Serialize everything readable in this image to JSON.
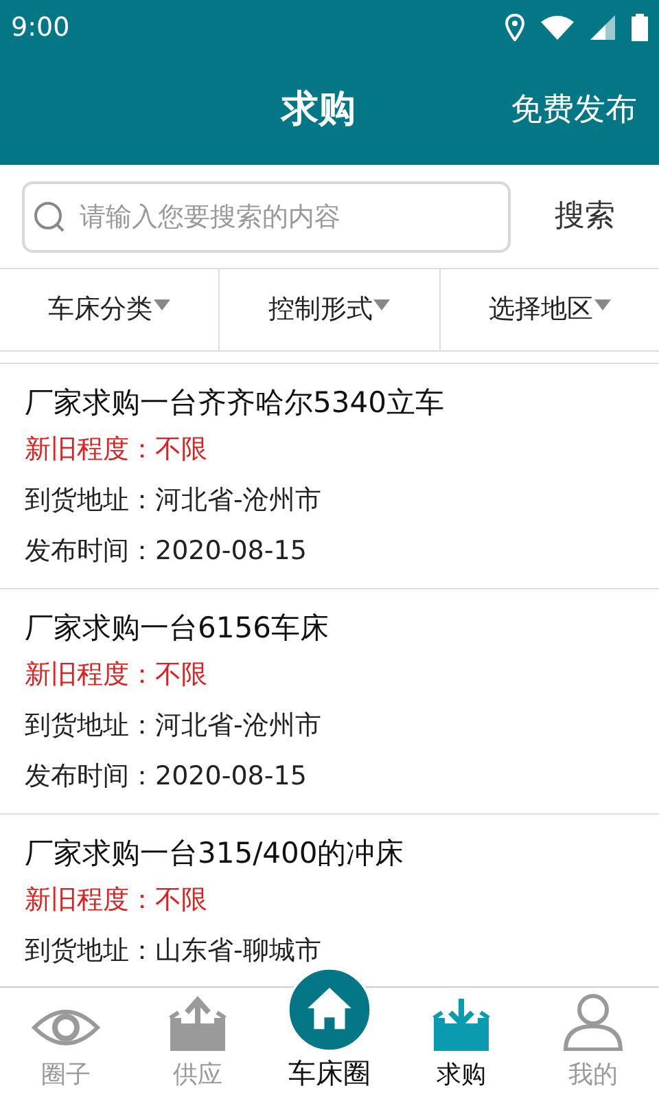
{
  "status_bar": {
    "time": "9:00"
  },
  "header": {
    "title": "求购",
    "action": "免费发布"
  },
  "search": {
    "placeholder": "请输入您要搜索的内容",
    "button": "搜索"
  },
  "filters": [
    {
      "label": "车床分类"
    },
    {
      "label": "控制形式"
    },
    {
      "label": "选择地区"
    }
  ],
  "listings": [
    {
      "title": "厂家求购一台齐齐哈尔5340立车",
      "condition": "新旧程度：不限",
      "address": "到货地址：河北省-沧州市",
      "date": "发布时间：2020-08-15"
    },
    {
      "title": "厂家求购一台6156车床",
      "condition": "新旧程度：不限",
      "address": "到货地址：河北省-沧州市",
      "date": "发布时间：2020-08-15"
    },
    {
      "title": "厂家求购一台315/400的冲床",
      "condition": "新旧程度：不限",
      "address": "到货地址：山东省-聊城市"
    }
  ],
  "nav": [
    {
      "label": "圈子",
      "kind": "eye",
      "selected": false
    },
    {
      "label": "供应",
      "kind": "upload",
      "selected": false
    },
    {
      "label": "车床圈",
      "kind": "center",
      "selected": false
    },
    {
      "label": "求购",
      "kind": "download",
      "selected": true
    },
    {
      "label": "我的",
      "kind": "user",
      "selected": false
    }
  ]
}
